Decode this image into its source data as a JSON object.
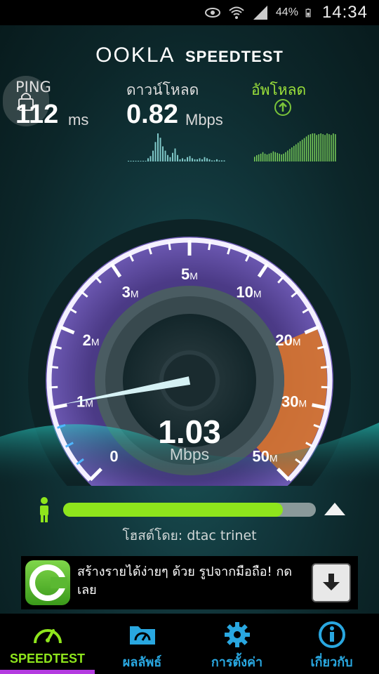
{
  "status_bar": {
    "battery_percent": "44%",
    "time": "14:34"
  },
  "brand": {
    "name": "OOKLA",
    "product": "SPEEDTEST"
  },
  "ping": {
    "label": "PING",
    "value": "112",
    "unit": "ms"
  },
  "download": {
    "label": "ดาวน์โหลด",
    "value": "0.82",
    "unit": "Mbps",
    "graph": [
      0,
      0,
      0,
      0,
      0,
      0,
      0,
      0,
      3,
      5,
      10,
      18,
      26,
      22,
      14,
      10,
      6,
      4,
      8,
      12,
      6,
      2,
      3,
      2,
      4,
      5,
      3,
      2,
      2,
      3,
      2,
      4,
      3,
      2,
      1,
      1,
      2,
      1,
      1,
      1
    ]
  },
  "upload": {
    "label": "อัพโหลด",
    "graph": [
      6,
      8,
      9,
      10,
      12,
      10,
      9,
      10,
      11,
      13,
      12,
      11,
      10,
      9,
      10,
      12,
      14,
      16,
      18,
      20,
      22,
      24,
      26,
      28,
      30,
      32,
      34,
      35,
      36,
      36,
      34,
      35,
      36,
      35,
      34,
      36,
      35,
      34,
      36,
      35
    ]
  },
  "gauge": {
    "tick_labels": [
      {
        "num": "0",
        "unit": ""
      },
      {
        "num": "1",
        "unit": "M"
      },
      {
        "num": "2",
        "unit": "M"
      },
      {
        "num": "3",
        "unit": "M"
      },
      {
        "num": "5",
        "unit": "M"
      },
      {
        "num": "10",
        "unit": "M"
      },
      {
        "num": "20",
        "unit": "M"
      },
      {
        "num": "30",
        "unit": "M"
      },
      {
        "num": "50",
        "unit": "M"
      }
    ],
    "speed_value": "1.03",
    "speed_unit": "Mbps",
    "needle_position": 1.02
  },
  "progress": {
    "fraction": 0.87
  },
  "host": {
    "text": "โฮสต์โดย: dtac trinet"
  },
  "ad": {
    "text": "สร้างรายได้ง่ายๆ ด้วย รูปจากมือถือ! กดเลย"
  },
  "nav": {
    "items": [
      {
        "label": "SPEEDTEST",
        "icon": "gauge-icon"
      },
      {
        "label": "ผลลัพธ์",
        "icon": "results-folder-icon"
      },
      {
        "label": "การตั้งค่า",
        "icon": "gear-icon"
      },
      {
        "label": "เกี่ยวกับ",
        "icon": "info-icon"
      }
    ]
  },
  "colors": {
    "accent_green": "#8ee51c",
    "accent_blue": "#29a7e0",
    "active_underline": "#b43be0",
    "gauge_orange": "#e07a2a"
  }
}
